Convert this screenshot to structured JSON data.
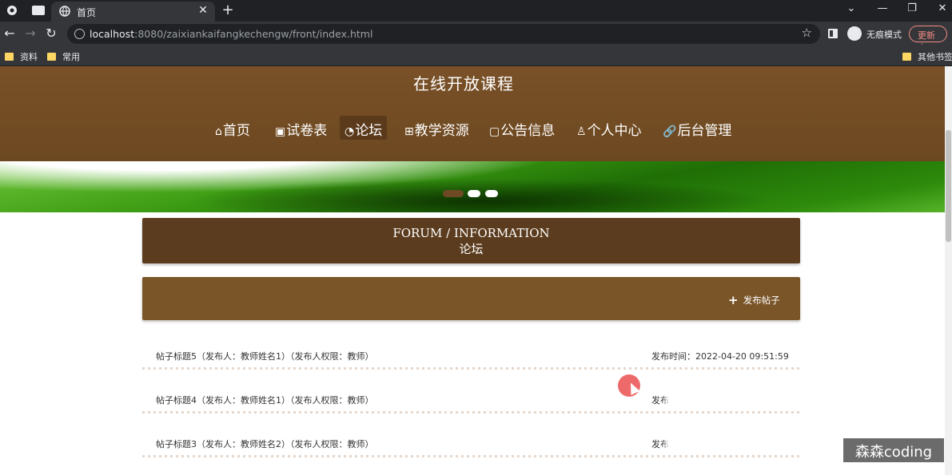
{
  "browser": {
    "tab_title": "首页",
    "new_tab_symbol": "+",
    "tab_close_symbol": "✕",
    "url_host": "localhost",
    "url_rest": ":8080/zaixiankaifangkechengw/front/index.html",
    "incognito_label": "无痕模式",
    "update_label": "更新",
    "window_controls": [
      "⌄",
      "—",
      "❐",
      "✕"
    ],
    "bookmarks": [
      "资料",
      "常用"
    ],
    "other_bookmarks": "其他书签"
  },
  "site": {
    "title": "在线开放课程",
    "nav": [
      {
        "label": "首页",
        "icon": "⌂"
      },
      {
        "label": "试卷表",
        "icon": "▣"
      },
      {
        "label": "论坛",
        "icon": "◔",
        "active": true
      },
      {
        "label": "教学资源",
        "icon": "⊞"
      },
      {
        "label": "公告信息",
        "icon": "▢"
      },
      {
        "label": "个人中心",
        "icon": "♙"
      },
      {
        "label": "后台管理",
        "icon": "🔗"
      }
    ],
    "carousel": {
      "slides": 3,
      "active_index": 0
    }
  },
  "forum": {
    "heading_en": "FORUM / INFORMATION",
    "heading_zh": "论坛",
    "post_button": "发布帖子",
    "posts": [
      {
        "title": "帖子标题5（发布人：教师姓名1）（发布人权限：教师）",
        "time": "发布时间：2022-04-20 09:51:59"
      },
      {
        "title": "帖子标题4（发布人：教师姓名1）（发布人权限：教师）",
        "time": "发布"
      },
      {
        "title": "帖子标题3（发布人：教师姓名2）（发布人权限：教师）",
        "time": "发布"
      }
    ]
  },
  "watermark": "森森coding",
  "colors": {
    "header": "#6e4a23",
    "forum_head": "#5c3c1e",
    "action_bar": "#7a5528",
    "banner_green": "#3b9b12"
  }
}
